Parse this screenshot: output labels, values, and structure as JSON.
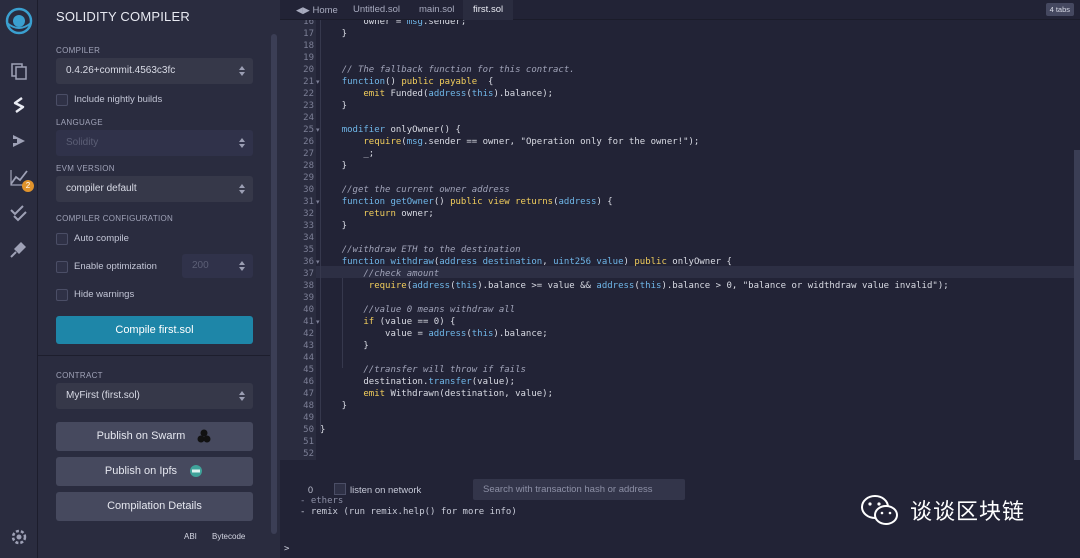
{
  "sidebar": {
    "title": "SOLIDITY COMPILER",
    "compiler_label": "COMPILER",
    "compiler_version": "0.4.26+commit.4563c3fc",
    "include_nightly": "Include nightly builds",
    "language_label": "LANGUAGE",
    "language_value": "Solidity",
    "evm_label": "EVM VERSION",
    "evm_value": "compiler default",
    "config_label": "COMPILER CONFIGURATION",
    "auto_compile": "Auto compile",
    "enable_optimization": "Enable optimization",
    "optimization_runs": "200",
    "hide_warnings": "Hide warnings",
    "compile_button": "Compile first.sol",
    "contract_label": "CONTRACT",
    "contract_value": "MyFirst (first.sol)",
    "publish_swarm": "Publish on Swarm",
    "publish_ipfs": "Publish on Ipfs",
    "compilation_details": "Compilation Details",
    "abi": "ABI",
    "bytecode": "Bytecode",
    "notification_count": "2"
  },
  "tabs": {
    "home": "Home",
    "items": [
      "Untitled.sol",
      "main.sol",
      "first.sol"
    ],
    "count": "4 tabs"
  },
  "editor": {
    "line_numbers": [
      "16",
      "17",
      "18",
      "19",
      "20",
      "21",
      "22",
      "23",
      "24",
      "25",
      "26",
      "27",
      "28",
      "29",
      "30",
      "31",
      "32",
      "33",
      "34",
      "35",
      "36",
      "37",
      "38",
      "39",
      "40",
      "41",
      "42",
      "43",
      "44",
      "45",
      "46",
      "47",
      "48",
      "49",
      "50",
      "51",
      "52"
    ],
    "folded_lines": [
      "21",
      "25",
      "31",
      "36",
      "41"
    ]
  },
  "terminal": {
    "count": "0",
    "listen": "listen on network",
    "search_placeholder": "Search with transaction hash or address",
    "line_partial": "- ethers",
    "line_remix": "- remix (run remix.help() for more info)",
    "prompt": ">"
  },
  "watermark": {
    "text": "谈谈区块链"
  },
  "colors": {
    "accent": "#1e86a8",
    "keyword": "#6fb6e8",
    "modifier": "#f1cd5c",
    "badge": "#e0932c"
  }
}
